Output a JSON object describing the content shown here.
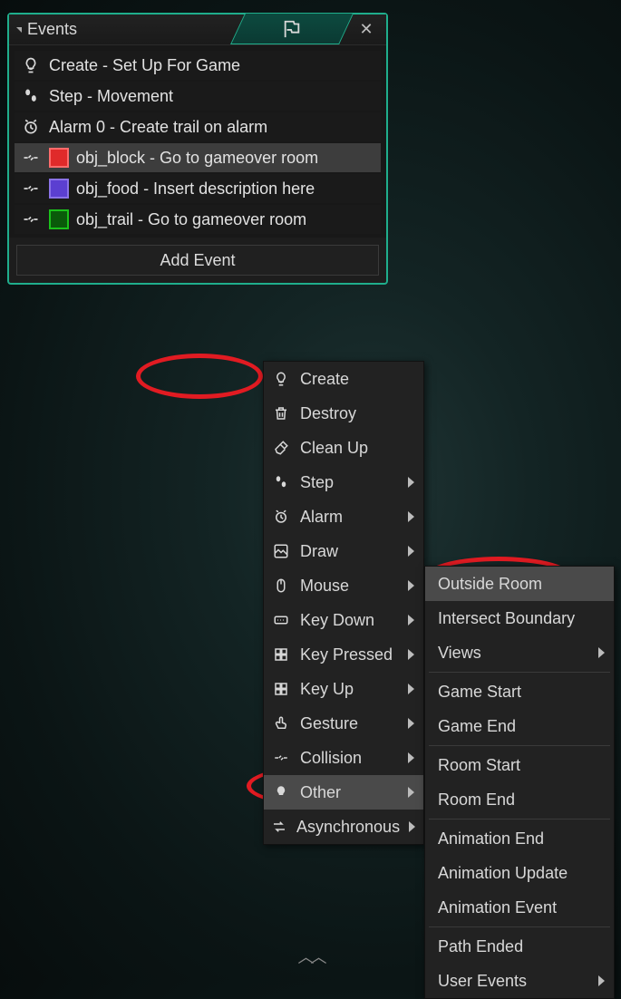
{
  "panel": {
    "title": "Events",
    "add_button": "Add Event"
  },
  "events": [
    {
      "icon": "bulb",
      "label": "Create - Set Up For Game"
    },
    {
      "icon": "steps",
      "label": "Step - Movement"
    },
    {
      "icon": "clock",
      "label": "Alarm 0 - Create trail on alarm"
    },
    {
      "icon": "collision",
      "color": "#e02a2a",
      "label": "obj_block - Go to gameover room",
      "selected": true
    },
    {
      "icon": "collision",
      "color": "#5b3fd1",
      "label": "obj_food - Insert description here"
    },
    {
      "icon": "collision",
      "color": "#0a7a0a",
      "label": "obj_trail - Go to gameover room"
    }
  ],
  "menu": {
    "items": [
      {
        "label": "Create"
      },
      {
        "label": "Destroy"
      },
      {
        "label": "Clean Up"
      },
      {
        "label": "Step",
        "submenu": true
      },
      {
        "label": "Alarm",
        "submenu": true
      },
      {
        "label": "Draw",
        "submenu": true
      },
      {
        "label": "Mouse",
        "submenu": true
      },
      {
        "label": "Key Down",
        "submenu": true
      },
      {
        "label": "Key Pressed",
        "submenu": true
      },
      {
        "label": "Key Up",
        "submenu": true
      },
      {
        "label": "Gesture",
        "submenu": true
      },
      {
        "label": "Collision",
        "submenu": true
      },
      {
        "label": "Other",
        "submenu": true,
        "highlight": true
      },
      {
        "label": "Asynchronous",
        "submenu": true
      }
    ]
  },
  "submenu": {
    "items": [
      {
        "label": "Outside Room",
        "highlight": true
      },
      {
        "label": "Intersect Boundary"
      },
      {
        "label": "Views",
        "submenu": true,
        "sep_after": true
      },
      {
        "label": "Game Start"
      },
      {
        "label": "Game End",
        "sep_after": true
      },
      {
        "label": "Room Start"
      },
      {
        "label": "Room End",
        "sep_after": true
      },
      {
        "label": "Animation End"
      },
      {
        "label": "Animation Update"
      },
      {
        "label": "Animation Event",
        "sep_after": true
      },
      {
        "label": "Path Ended"
      },
      {
        "label": "User Events",
        "submenu": true
      }
    ]
  }
}
